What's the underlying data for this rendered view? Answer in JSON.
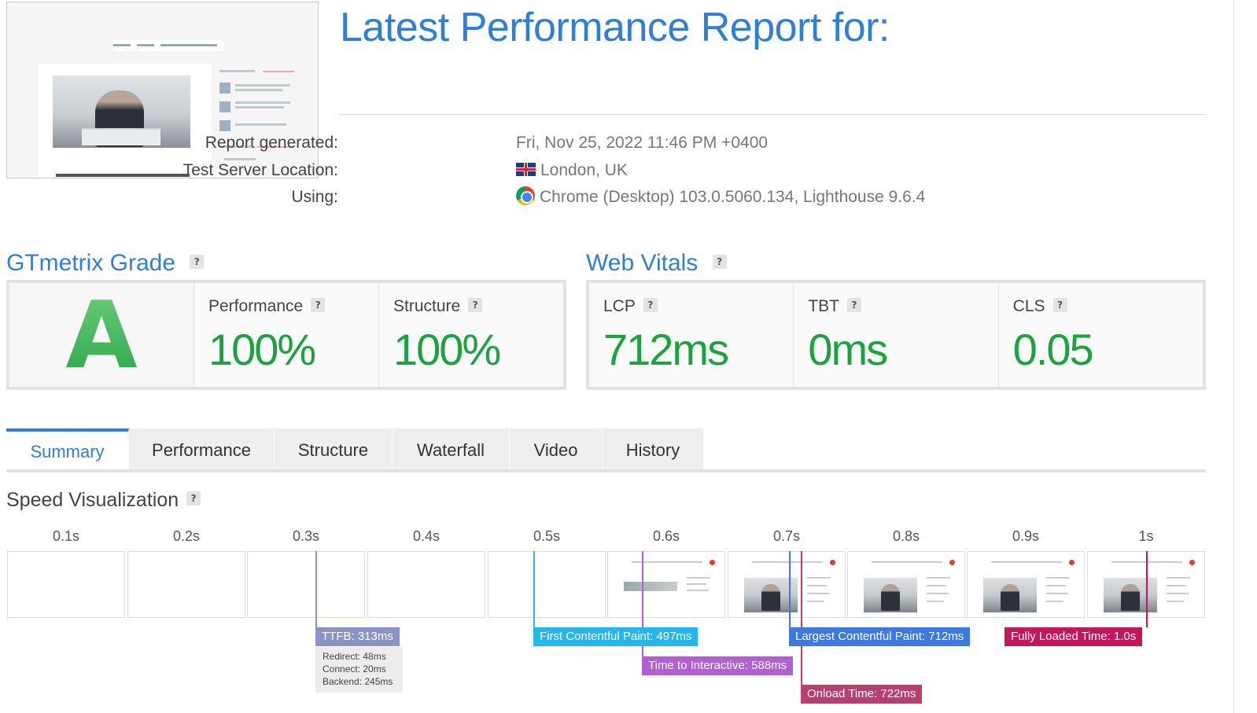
{
  "report": {
    "title": "Latest Performance Report for:",
    "generated_label": "Report generated:",
    "generated_value": "Fri, Nov 25, 2022 11:46 PM +0400",
    "location_label": "Test Server Location:",
    "location_value": "London, UK",
    "location_icon": "uk-flag-icon",
    "using_label": "Using:",
    "using_value": "Chrome (Desktop) 103.0.5060.134, Lighthouse 9.6.4",
    "using_icon": "chrome-icon"
  },
  "grade": {
    "title": "GTmetrix Grade",
    "help": "?",
    "letter": "A",
    "performance_label": "Performance",
    "performance_value": "100%",
    "structure_label": "Structure",
    "structure_value": "100%"
  },
  "vitals": {
    "title": "Web Vitals",
    "help": "?",
    "lcp_label": "LCP",
    "lcp_value": "712ms",
    "tbt_label": "TBT",
    "tbt_value": "0ms",
    "cls_label": "CLS",
    "cls_value": "0.05"
  },
  "tabs": [
    {
      "label": "Summary",
      "active": true
    },
    {
      "label": "Performance"
    },
    {
      "label": "Structure"
    },
    {
      "label": "Waterfall"
    },
    {
      "label": "Video"
    },
    {
      "label": "History"
    }
  ],
  "speed": {
    "title": "Speed Visualization",
    "help": "?",
    "ticks": [
      "0.1s",
      "0.2s",
      "0.3s",
      "0.4s",
      "0.5s",
      "0.6s",
      "0.7s",
      "0.8s",
      "0.9s",
      "1s"
    ],
    "markers": {
      "ttfb": "TTFB: 313ms",
      "redirect": "Redirect: 48ms",
      "connect": "Connect: 20ms",
      "backend": "Backend: 245ms",
      "fcp": "First Contentful Paint: 497ms",
      "tti": "Time to Interactive: 588ms",
      "lcp": "Largest Contentful Paint: 712ms",
      "onload": "Onload Time: 722ms",
      "fully_loaded": "Fully Loaded Time: 1.0s"
    }
  },
  "colors": {
    "accent": "#2f7fd6",
    "good": "#1aa33e",
    "ttfb": "#8a94c6",
    "fcp": "#27b6ec",
    "tti": "#b15fd1",
    "lcp": "#3c7ae0",
    "onload": "#b7406e",
    "fully_loaded": "#c2185b"
  }
}
